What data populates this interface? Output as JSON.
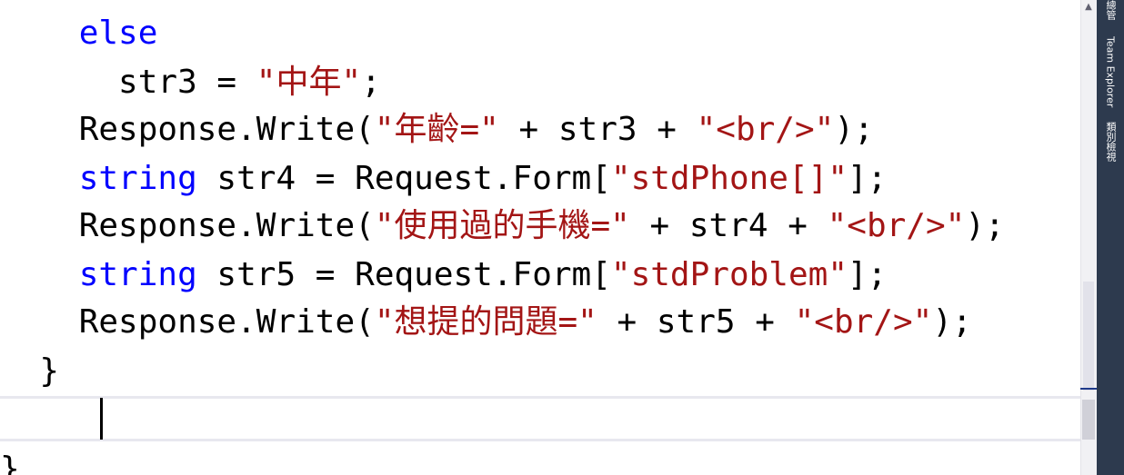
{
  "editor": {
    "lines": [
      {
        "indent": "    ",
        "tokens": [
          {
            "t": "else",
            "c": "kw"
          }
        ]
      },
      {
        "indent": "      ",
        "tokens": [
          {
            "t": "str3 = ",
            "c": ""
          },
          {
            "t": "\"中年\"",
            "c": "str"
          },
          {
            "t": ";",
            "c": ""
          }
        ]
      },
      {
        "indent": "    ",
        "tokens": [
          {
            "t": "Response.Write(",
            "c": ""
          },
          {
            "t": "\"年齡=\"",
            "c": "str"
          },
          {
            "t": " + str3 + ",
            "c": ""
          },
          {
            "t": "\"<br/>\"",
            "c": "str"
          },
          {
            "t": ");",
            "c": ""
          }
        ]
      },
      {
        "indent": "    ",
        "tokens": [
          {
            "t": "string",
            "c": "kw"
          },
          {
            "t": " str4 = Request.Form[",
            "c": ""
          },
          {
            "t": "\"stdPhone[]\"",
            "c": "str"
          },
          {
            "t": "];",
            "c": ""
          }
        ]
      },
      {
        "indent": "    ",
        "tokens": [
          {
            "t": "Response.Write(",
            "c": ""
          },
          {
            "t": "\"使用過的手機=\"",
            "c": "str"
          },
          {
            "t": " + str4 + ",
            "c": ""
          },
          {
            "t": "\"<br/>\"",
            "c": "str"
          },
          {
            "t": ");",
            "c": ""
          }
        ]
      },
      {
        "indent": "    ",
        "tokens": [
          {
            "t": "string",
            "c": "kw"
          },
          {
            "t": " str5 = Request.Form[",
            "c": ""
          },
          {
            "t": "\"stdProblem\"",
            "c": "str"
          },
          {
            "t": "];",
            "c": ""
          }
        ]
      },
      {
        "indent": "    ",
        "tokens": [
          {
            "t": "Response.Write(",
            "c": ""
          },
          {
            "t": "\"想提的問題=\"",
            "c": "str"
          },
          {
            "t": " + str5 + ",
            "c": ""
          },
          {
            "t": "\"<br/>\"",
            "c": "str"
          },
          {
            "t": ");",
            "c": ""
          }
        ]
      },
      {
        "indent": "  ",
        "tokens": [
          {
            "t": "}",
            "c": ""
          }
        ]
      },
      {
        "indent": "",
        "tokens": []
      },
      {
        "indent": "",
        "tokens": [
          {
            "t": "}",
            "c": ""
          }
        ]
      }
    ]
  },
  "side_panel": {
    "tabs": [
      "總管",
      "Team Explorer",
      "類別檢視"
    ]
  },
  "colors": {
    "keyword": "#0000ff",
    "string": "#a31515",
    "text": "#000000",
    "change_bar": "#2bb34a",
    "panel": "#2d3a4e"
  }
}
